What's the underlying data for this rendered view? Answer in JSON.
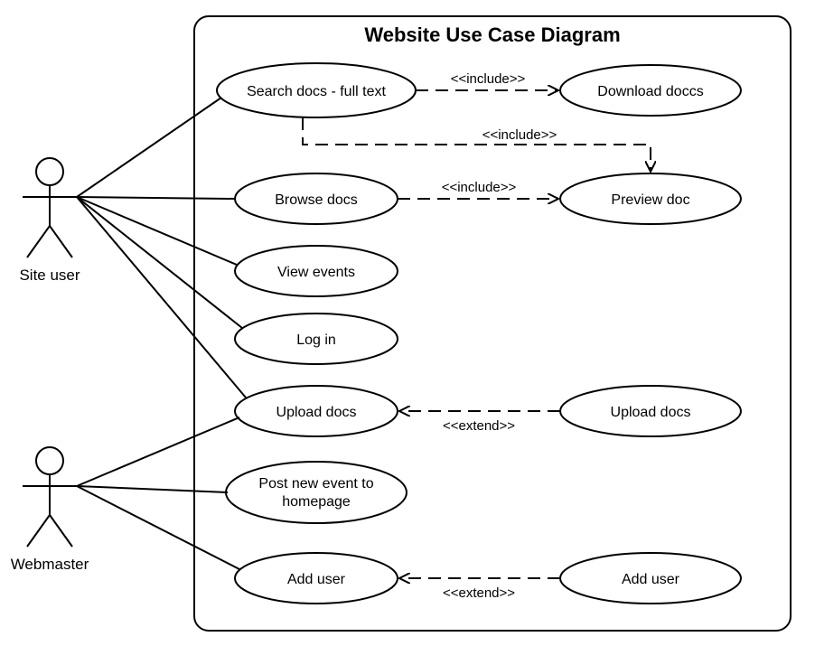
{
  "diagram": {
    "title": "Website Use Case Diagram",
    "actors": {
      "site_user": "Site user",
      "webmaster": "Webmaster"
    },
    "usecases": {
      "search_docs": "Search docs - full text",
      "download_docs": "Download doccs",
      "browse_docs": "Browse docs",
      "preview_doc": "Preview doc",
      "view_events": "View events",
      "log_in": "Log in",
      "upload_docs": "Upload docs",
      "upload_docs2": "Upload docs",
      "post_event_l1": "Post new event to",
      "post_event_l2": "homepage",
      "add_user": "Add user",
      "add_user2": "Add user"
    },
    "relations": {
      "include": "<<include>>",
      "extend": "<<extend>>"
    }
  }
}
